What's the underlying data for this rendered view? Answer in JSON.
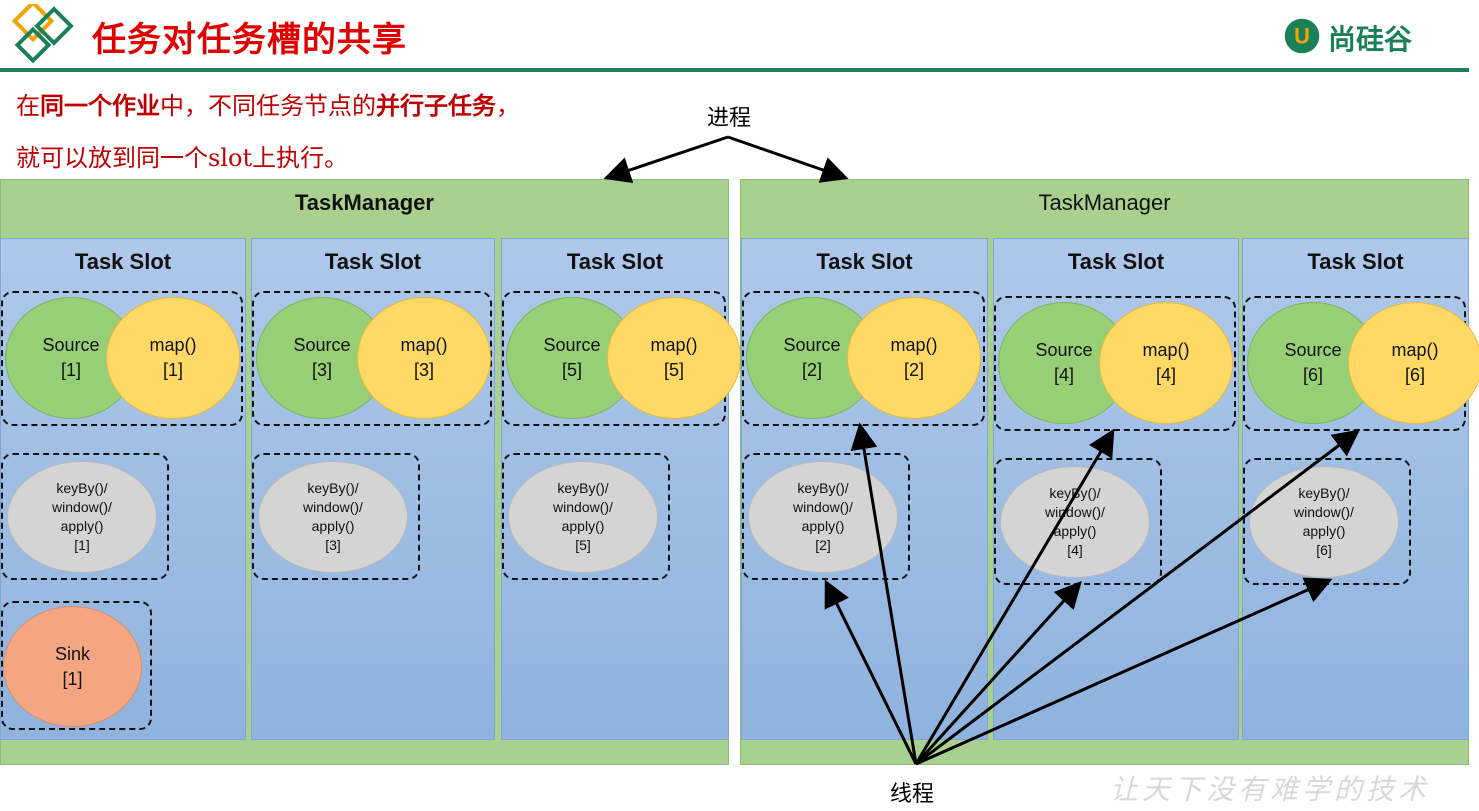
{
  "title": "任务对任务槽的共享",
  "brand": {
    "name": "尚硅谷",
    "logo_letter": "U",
    "colors": {
      "primary": "#1b7f5a",
      "accent": "#f0a500"
    }
  },
  "intro": {
    "line1_parts": [
      "在",
      "同一个作业",
      "中，不同任务节点的",
      "并行子任务",
      "，"
    ],
    "line2": "就可以放到同一个slot上执行。"
  },
  "labels": {
    "process": "进程",
    "thread": "线程"
  },
  "slogan": "让天下没有难学的技术",
  "task_managers": [
    {
      "title": "TaskManager",
      "slots": [
        {
          "title": "Task Slot",
          "source": [
            "Source",
            "[1]"
          ],
          "map": [
            "map()",
            "[1]"
          ],
          "keyby": [
            "keyBy()/",
            "window()/",
            "apply()",
            "[1]"
          ],
          "sink": [
            "Sink",
            "[1]"
          ]
        },
        {
          "title": "Task Slot",
          "source": [
            "Source",
            "[3]"
          ],
          "map": [
            "map()",
            "[3]"
          ],
          "keyby": [
            "keyBy()/",
            "window()/",
            "apply()",
            "[3]"
          ]
        },
        {
          "title": "Task Slot",
          "source": [
            "Source",
            "[5]"
          ],
          "map": [
            "map()",
            "[5]"
          ],
          "keyby": [
            "keyBy()/",
            "window()/",
            "apply()",
            "[5]"
          ]
        }
      ]
    },
    {
      "title": "TaskManager",
      "slots": [
        {
          "title": "Task Slot",
          "source": [
            "Source",
            "[2]"
          ],
          "map": [
            "map()",
            "[2]"
          ],
          "keyby": [
            "keyBy()/",
            "window()/",
            "apply()",
            "[2]"
          ]
        },
        {
          "title": "Task Slot",
          "source": [
            "Source",
            "[4]"
          ],
          "map": [
            "map()",
            "[4]"
          ],
          "keyby": [
            "keyBy()/",
            "window()/",
            "apply()",
            "[4]"
          ]
        },
        {
          "title": "Task Slot",
          "source": [
            "Source",
            "[6]"
          ],
          "map": [
            "map()",
            "[6]"
          ],
          "keyby": [
            "keyBy()/",
            "window()/",
            "apply()",
            "[6]"
          ]
        }
      ]
    }
  ]
}
